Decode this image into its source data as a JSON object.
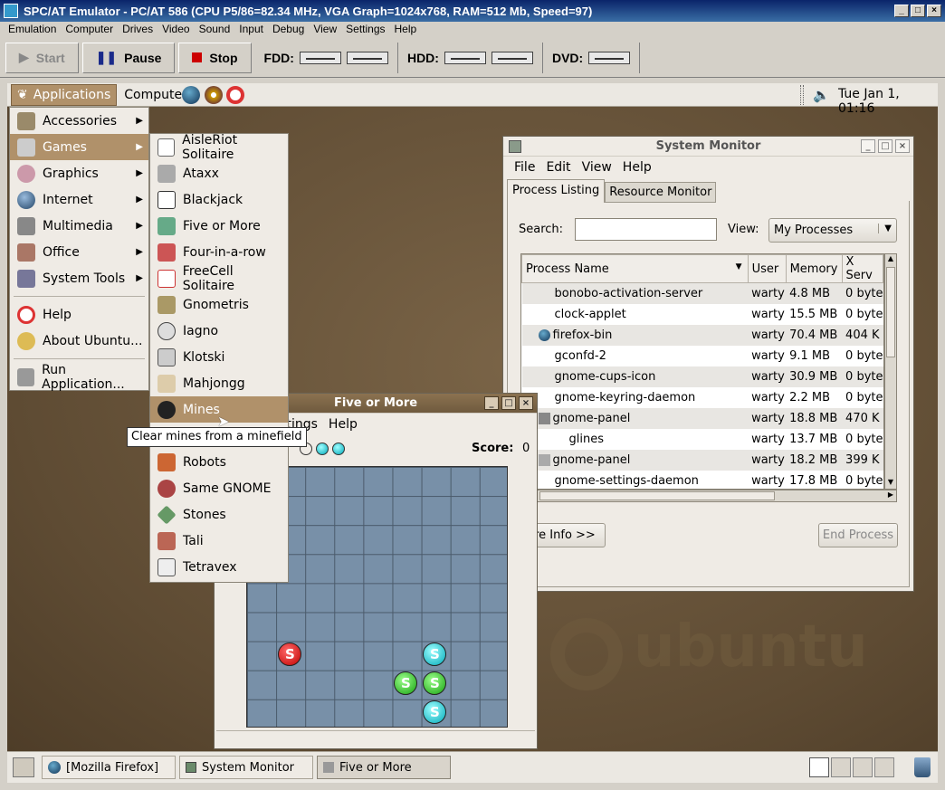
{
  "emulator": {
    "title": "SPC/AT Emulator - PC/AT 586 (CPU P5/86=82.34 MHz, VGA Graph=1024x768, RAM=512 Mb, Speed=97)",
    "menu": [
      "Emulation",
      "Computer",
      "Drives",
      "Video",
      "Sound",
      "Input",
      "Debug",
      "View",
      "Settings",
      "Help"
    ],
    "toolbar": {
      "start": "Start",
      "pause": "Pause",
      "stop": "Stop",
      "fdd": "FDD:",
      "hdd": "HDD:",
      "dvd": "DVD:"
    }
  },
  "top_panel": {
    "applications": "Applications",
    "computer": "Computer",
    "clock": "Tue Jan  1, 01:16"
  },
  "apps_menu": [
    {
      "label": "Accessories",
      "arrow": "▶"
    },
    {
      "label": "Games",
      "arrow": "▶"
    },
    {
      "label": "Graphics",
      "arrow": "▶"
    },
    {
      "label": "Internet",
      "arrow": "▶"
    },
    {
      "label": "Multimedia",
      "arrow": "▶"
    },
    {
      "label": "Office",
      "arrow": "▶"
    },
    {
      "label": "System Tools",
      "arrow": "▶"
    },
    {
      "label": "Help"
    },
    {
      "label": "About Ubuntu..."
    },
    {
      "label": "Run Application..."
    }
  ],
  "games_menu": [
    "AisleRiot Solitaire",
    "Ataxx",
    "Blackjack",
    "Five or More",
    "Four-in-a-row",
    "FreeCell Solitaire",
    "Gnometris",
    "Iagno",
    "Klotski",
    "Mahjongg",
    "Mines",
    "Robots",
    "Same GNOME",
    "Stones",
    "Tali",
    "Tetravex"
  ],
  "tooltip": "Clear mines from a minefield",
  "system_monitor": {
    "title": "System Monitor",
    "menu": [
      "File",
      "Edit",
      "View",
      "Help"
    ],
    "tabs": [
      "Process Listing",
      "Resource Monitor"
    ],
    "search_label": "Search:",
    "view_label": "View:",
    "view_value": "My Processes",
    "columns": [
      "Process Name",
      "User",
      "Memory",
      "X Serv"
    ],
    "rows": [
      {
        "name": "bonobo-activation-server",
        "user": "warty",
        "memory": "4.8 MB",
        "x": "0 byte"
      },
      {
        "name": "clock-applet",
        "user": "warty",
        "memory": "15.5 MB",
        "x": "0 byte"
      },
      {
        "name": "firefox-bin",
        "user": "warty",
        "memory": "70.4 MB",
        "x": "404 K"
      },
      {
        "name": "gconfd-2",
        "user": "warty",
        "memory": "9.1 MB",
        "x": "0 byte"
      },
      {
        "name": "gnome-cups-icon",
        "user": "warty",
        "memory": "30.9 MB",
        "x": "0 byte"
      },
      {
        "name": "gnome-keyring-daemon",
        "user": "warty",
        "memory": "2.2 MB",
        "x": "0 byte"
      },
      {
        "name": "gnome-panel",
        "user": "warty",
        "memory": "18.8 MB",
        "x": "470 K"
      },
      {
        "name": "glines",
        "user": "warty",
        "memory": "13.7 MB",
        "x": "0 byte"
      },
      {
        "name": "gnome-panel",
        "user": "warty",
        "memory": "18.2 MB",
        "x": "399 K"
      },
      {
        "name": "gnome-settings-daemon",
        "user": "warty",
        "memory": "17.8 MB",
        "x": "0 byte"
      }
    ],
    "more_info": "ore Info >>",
    "end_process": "End Process"
  },
  "five_or_more": {
    "title": "Five or More",
    "menu_partial": "ttings",
    "menu_help": "Help",
    "score_label": "Score:",
    "score": "0"
  },
  "taskbar": [
    "[Mozilla Firefox]",
    "System Monitor",
    "Five or More"
  ],
  "watermark": "ubuntu"
}
